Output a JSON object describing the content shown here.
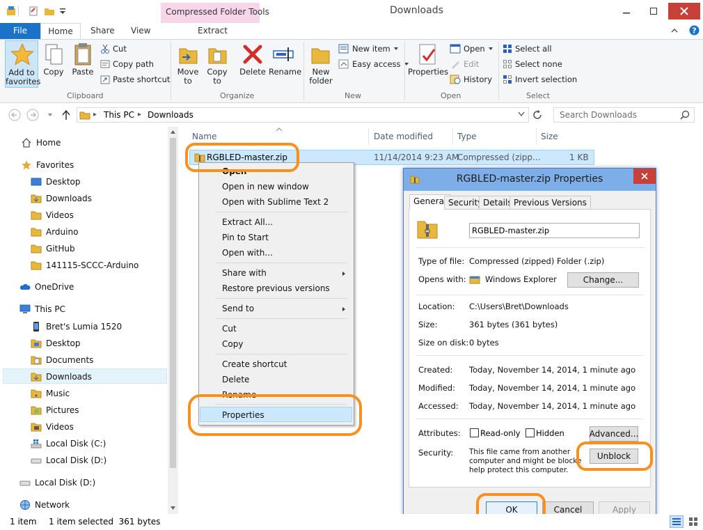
{
  "window": {
    "title": "Downloads",
    "contextual_group": "Compressed Folder Tools",
    "contextual_tab": "Extract"
  },
  "tabs": {
    "file": "File",
    "home": "Home",
    "share": "Share",
    "view": "View"
  },
  "ribbon": {
    "clipboard": {
      "label": "Clipboard",
      "add_favorites_1": "Add to",
      "add_favorites_2": "favorites",
      "copy": "Copy",
      "paste": "Paste",
      "cut": "Cut",
      "copy_path": "Copy path",
      "paste_shortcut": "Paste shortcut"
    },
    "organize": {
      "label": "Organize",
      "move_to_1": "Move",
      "move_to_2": "to",
      "copy_to_1": "Copy",
      "copy_to_2": "to",
      "delete": "Delete",
      "rename": "Rename"
    },
    "new": {
      "label": "New",
      "new_folder_1": "New",
      "new_folder_2": "folder",
      "new_item": "New item",
      "easy_access": "Easy access"
    },
    "open": {
      "label": "Open",
      "properties": "Properties",
      "open": "Open",
      "edit": "Edit",
      "history": "History"
    },
    "select": {
      "label": "Select",
      "select_all": "Select all",
      "select_none": "Select none",
      "invert": "Invert selection"
    }
  },
  "address": {
    "crumbs": [
      "This PC",
      "Downloads"
    ],
    "search_placeholder": "Search Downloads"
  },
  "nav": {
    "home": "Home",
    "favorites": "Favorites",
    "fav_items": [
      "Desktop",
      "Downloads",
      "Videos",
      "Arduino",
      "GitHub",
      "141115-SCCC-Arduino"
    ],
    "onedrive": "OneDrive",
    "thispc": "This PC",
    "pc_items": [
      "Bret's Lumia 1520",
      "Desktop",
      "Documents",
      "Downloads",
      "Music",
      "Pictures",
      "Videos",
      "Local Disk (C:)",
      "Local Disk (D:)"
    ],
    "local_disk_d": "Local Disk (D:)",
    "network": "Network"
  },
  "columns": {
    "name": "Name",
    "date": "Date modified",
    "type": "Type",
    "size": "Size"
  },
  "file": {
    "name": "RGBLED-master.zip",
    "date": "11/14/2014 9:23 AM",
    "type": "Compressed (zipp...",
    "size": "1 KB"
  },
  "context_menu": {
    "open": "Open",
    "open_new_window": "Open in new window",
    "open_sublime": "Open with Sublime Text 2",
    "extract_all": "Extract All...",
    "pin_start": "Pin to Start",
    "open_with": "Open with...",
    "share_with": "Share with",
    "restore": "Restore previous versions",
    "send_to": "Send to",
    "cut": "Cut",
    "copy": "Copy",
    "create_shortcut": "Create shortcut",
    "delete": "Delete",
    "rename": "Rename",
    "properties": "Properties"
  },
  "dialog": {
    "title": "RGBLED-master.zip Properties",
    "tabs": [
      "General",
      "Security",
      "Details",
      "Previous Versions"
    ],
    "filename": "RGBLED-master.zip",
    "type_label": "Type of file:",
    "type_value": "Compressed (zipped) Folder (.zip)",
    "opens_label": "Opens with:",
    "opens_value": "Windows Explorer",
    "change": "Change...",
    "location_label": "Location:",
    "location_value": "C:\\Users\\Bret\\Downloads",
    "size_label": "Size:",
    "size_value": "361 bytes (361 bytes)",
    "disk_label": "Size on disk:",
    "disk_value": "0 bytes",
    "created_label": "Created:",
    "created_value": "Today, November 14, 2014, 1 minute ago",
    "modified_label": "Modified:",
    "modified_value": "Today, November 14, 2014, 1 minute ago",
    "accessed_label": "Accessed:",
    "accessed_value": "Today, November 14, 2014, 1 minute ago",
    "attributes_label": "Attributes:",
    "readonly": "Read-only",
    "hidden": "Hidden",
    "advanced": "Advanced...",
    "security_label": "Security:",
    "security_line1": "This file came from another",
    "security_line2": "computer and might be blocked to",
    "security_line3": "help protect this computer.",
    "unblock": "Unblock",
    "ok": "OK",
    "cancel": "Cancel",
    "apply": "Apply"
  },
  "status": {
    "count": "1 item",
    "selected": "1 item selected  361 bytes"
  },
  "colors": {
    "accent": "#1a73c8",
    "highlight": "#f7901e",
    "folder": "#e8b73c"
  }
}
